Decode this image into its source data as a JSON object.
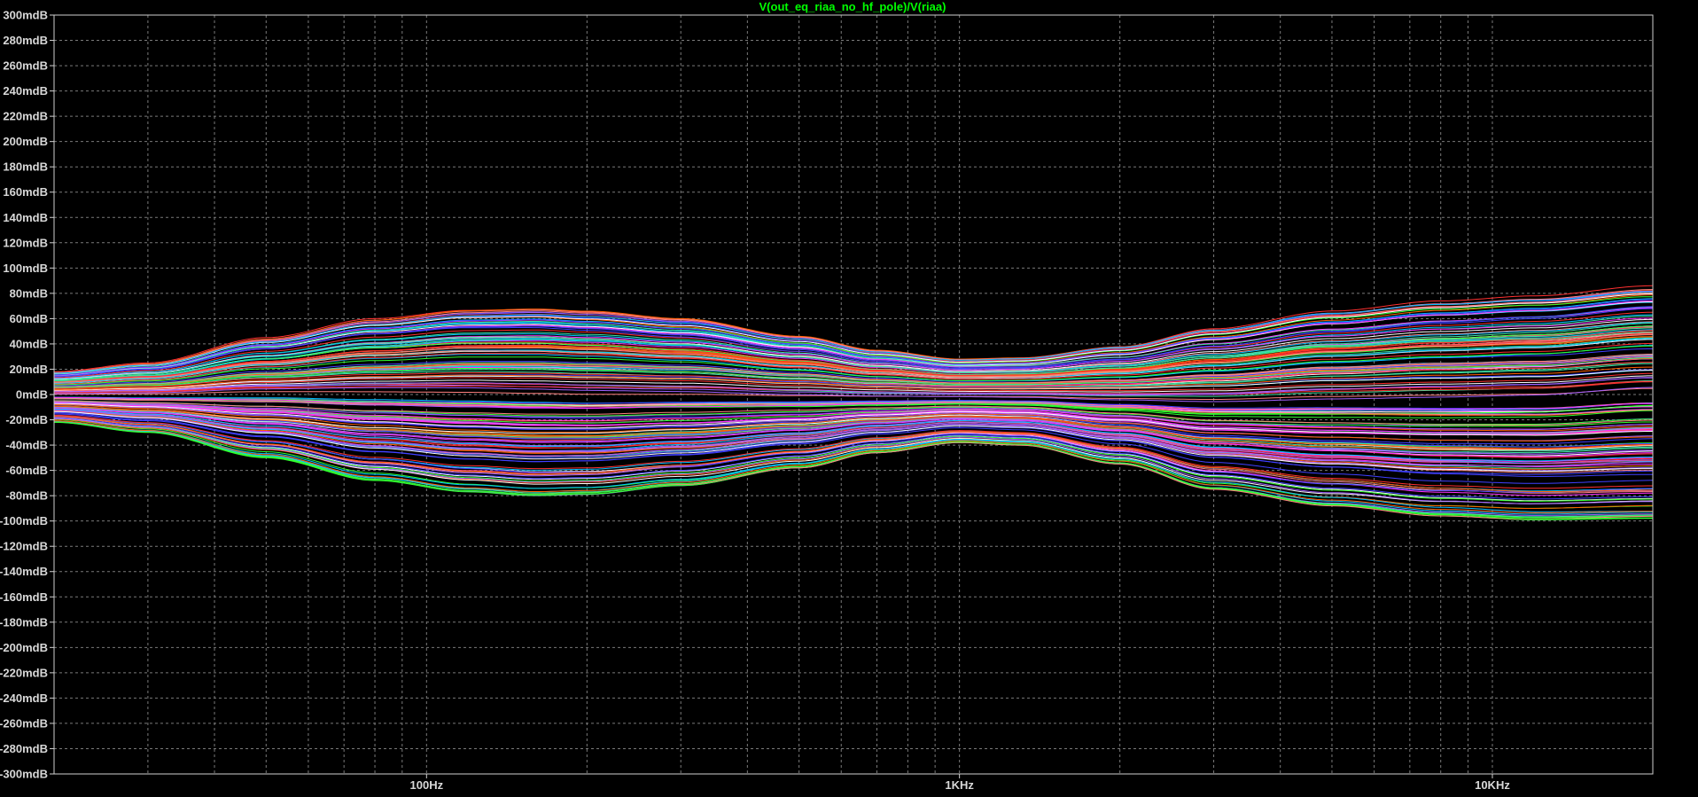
{
  "chart_data": {
    "type": "line",
    "title": "V(out_eq_riaa_no_hf_pole)/V(riaa)",
    "x_scale": "log",
    "xlim": [
      20,
      20000
    ],
    "ylim": [
      -300,
      300
    ],
    "grid": true,
    "y_unit": "mdB",
    "y_ticks": [
      "300mdB",
      "280mdB",
      "260mdB",
      "240mdB",
      "220mdB",
      "200mdB",
      "180mdB",
      "160mdB",
      "140mdB",
      "120mdB",
      "100mdB",
      "80mdB",
      "60mdB",
      "40mdB",
      "20mdB",
      "0mdB",
      "-20mdB",
      "-40mdB",
      "-60mdB",
      "-80mdB",
      "-100mdB",
      "-120mdB",
      "-140mdB",
      "-160mdB",
      "-180mdB",
      "-200mdB",
      "-220mdB",
      "-240mdB",
      "-260mdB",
      "-280mdB",
      "-300mdB"
    ],
    "x_ticks": [
      "100Hz",
      "1KHz",
      "10KHz"
    ],
    "envelope": {
      "description_values": "frequency (Hz) vs max/min response (mdB) of the family of curves",
      "x": [
        20,
        30,
        50,
        80,
        120,
        160,
        200,
        300,
        500,
        700,
        1000,
        1300,
        2000,
        3000,
        5000,
        8000,
        12000,
        20000
      ],
      "upper": [
        18,
        25,
        45,
        60,
        67,
        68,
        66,
        60,
        46,
        35,
        28,
        29,
        38,
        52,
        66,
        74,
        78,
        86
      ],
      "lower": [
        -22,
        -30,
        -50,
        -68,
        -77,
        -80,
        -79,
        -72,
        -58,
        -46,
        -38,
        -40,
        -55,
        -75,
        -88,
        -96,
        -99,
        -98
      ]
    },
    "series_count": 170,
    "series_colors": [
      "#ff3030",
      "#30ff30",
      "#4040ff",
      "#ff30ff",
      "#ffffff",
      "#ff8080",
      "#40e0a0",
      "#ff6000",
      "#a060ff",
      "#00c0ff"
    ],
    "title_color": "#00ff00",
    "grid_color": "#7a7a7a",
    "axis_color": "#d0d0d0"
  }
}
